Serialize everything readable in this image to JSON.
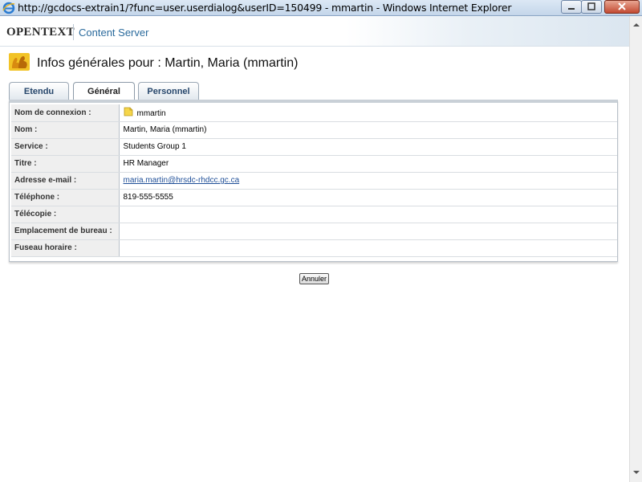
{
  "window": {
    "title": "http://gcdocs-extrain1/?func=user.userdialog&userID=150499 - mmartin - Windows Internet Explorer"
  },
  "header": {
    "logo": "OPENTEXT",
    "product": "Content Server"
  },
  "page": {
    "heading": "Infos générales pour : Martin, Maria (mmartin)"
  },
  "tabs": [
    {
      "label": "Etendu",
      "active": false
    },
    {
      "label": "Général",
      "active": true
    },
    {
      "label": "Personnel",
      "active": false
    }
  ],
  "fields": [
    {
      "label": "Nom de connexion :",
      "value": "mmartin"
    },
    {
      "label": "Nom :",
      "value": "Martin, Maria (mmartin)"
    },
    {
      "label": "Service :",
      "value": "Students Group 1"
    },
    {
      "label": "Titre :",
      "value": "HR Manager"
    },
    {
      "label": "Adresse e-mail :",
      "value": "maria.martin@hrsdc-rhdcc.gc.ca"
    },
    {
      "label": "Téléphone :",
      "value": "819-555-5555"
    },
    {
      "label": "Télécopie :",
      "value": ""
    },
    {
      "label": "Emplacement de bureau :",
      "value": ""
    },
    {
      "label": "Fuseau horaire :",
      "value": ""
    }
  ],
  "actions": {
    "cancel_label": "Annuler"
  },
  "colors": {
    "link": "#1f4f98",
    "product": "#2a6a9c",
    "label_bg": "#efefef"
  }
}
